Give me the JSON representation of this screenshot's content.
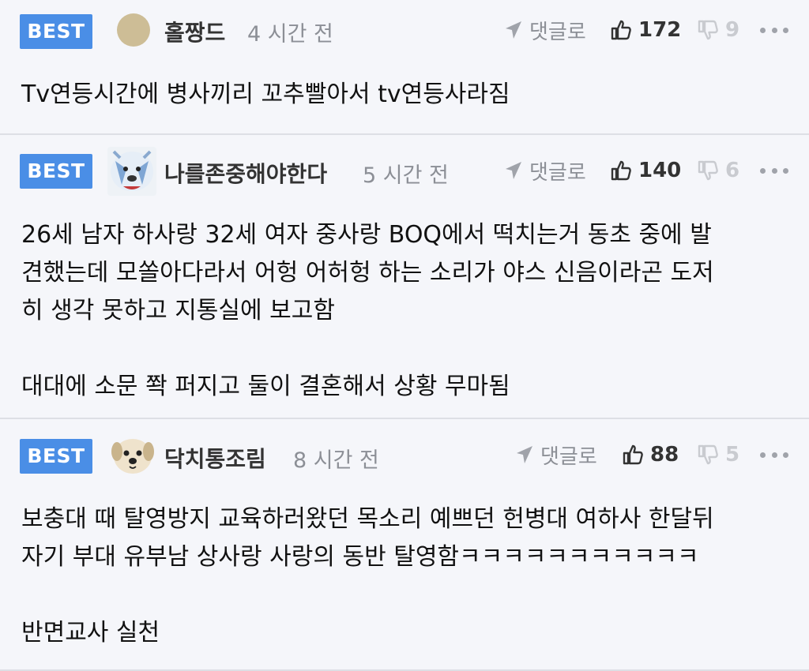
{
  "comments": [
    {
      "badge": "BEST",
      "avatar": "beige-circle-avatar",
      "nickname": "홀짱드",
      "time": "4 시간 전",
      "reply_label": "댓글로",
      "likes": "172",
      "dislikes": "9",
      "lines": [
        "Tv연등시간에 병사끼리 꼬추빨아서 tv연등사라짐"
      ]
    },
    {
      "badge": "BEST",
      "avatar": "polar-bear-avatar",
      "nickname": "나를존중해야한다",
      "time": "5 시간 전",
      "reply_label": "댓글로",
      "likes": "140",
      "dislikes": "6",
      "lines": [
        "26세 남자 하사랑 32세 여자 중사랑 BOQ에서 떡치는거 동초 중에 발",
        "견했는데 모쏠아다라서 어헝 어허헝 하는 소리가 야스 신음이라곤 도저",
        "히 생각 못하고 지통실에 보고함",
        "",
        "대대에 소문 쫙 퍼지고 둘이 결혼해서 상황 무마됨"
      ]
    },
    {
      "badge": "BEST",
      "avatar": "puppy-avatar",
      "nickname": "닥치통조림",
      "time": "8 시간 전",
      "reply_label": "댓글로",
      "likes": "88",
      "dislikes": "5",
      "lines": [
        "보충대 때 탈영방지 교육하러왔던 목소리 예쁘던 헌병대 여하사 한달뒤",
        "자기 부대 유부남 상사랑 사랑의 동반 탈영함ㅋㅋㅋㅋㅋㅋㅋㅋㅋㅋㅋ",
        "",
        "반면교사 실천"
      ]
    }
  ],
  "colors": {
    "badge": "#4a8ee6",
    "background": "#f5f6fa",
    "divider": "#dddfe5",
    "muted": "#8c8f96"
  }
}
